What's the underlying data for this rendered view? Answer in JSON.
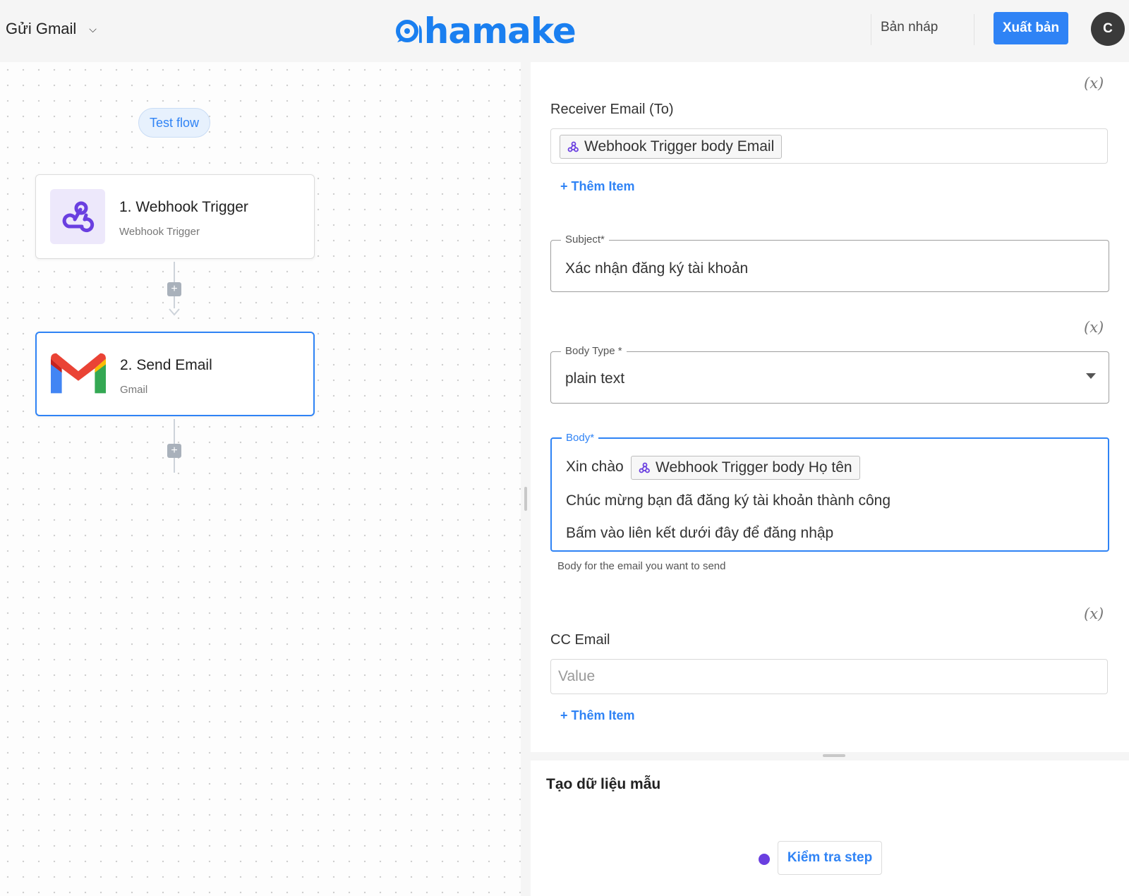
{
  "header": {
    "flow_name": "Gửi Gmail",
    "logo_text": "ahamake",
    "draft_label": "Bản nháp",
    "publish_label": "Xuất bản",
    "avatar_initial": "C",
    "brand_color": "#2f83f5"
  },
  "canvas": {
    "test_flow_label": "Test flow",
    "nodes": [
      {
        "title": "1. Webhook Trigger",
        "subtitle": "Webhook Trigger",
        "icon": "webhook-icon"
      },
      {
        "title": "2. Send Email",
        "subtitle": "Gmail",
        "icon": "gmail-icon"
      }
    ]
  },
  "form": {
    "var_symbol": "(x)",
    "receiver": {
      "label": "Receiver Email (To)",
      "chip": "Webhook Trigger body Email",
      "add_item": "+ Thêm Item"
    },
    "subject": {
      "label": "Subject*",
      "value": "Xác nhận đăng ký tài khoản"
    },
    "body_type": {
      "label": "Body Type *",
      "value": "plain text"
    },
    "body": {
      "label": "Body*",
      "line1_prefix": "Xin chào",
      "line1_chip": "Webhook Trigger body Họ tên",
      "line2": "Chúc mừng bạn đã đăng ký tài khoản thành công",
      "line3": "Bấm vào liên kết dưới đây để đăng nhập",
      "helper": "Body for the email you want to send"
    },
    "cc": {
      "label": "CC Email",
      "placeholder": "Value",
      "add_item": "+ Thêm Item"
    }
  },
  "sample": {
    "title": "Tạo dữ liệu mẫu",
    "test_step_label": "Kiểm tra step",
    "status_color": "#6a3fe0"
  }
}
